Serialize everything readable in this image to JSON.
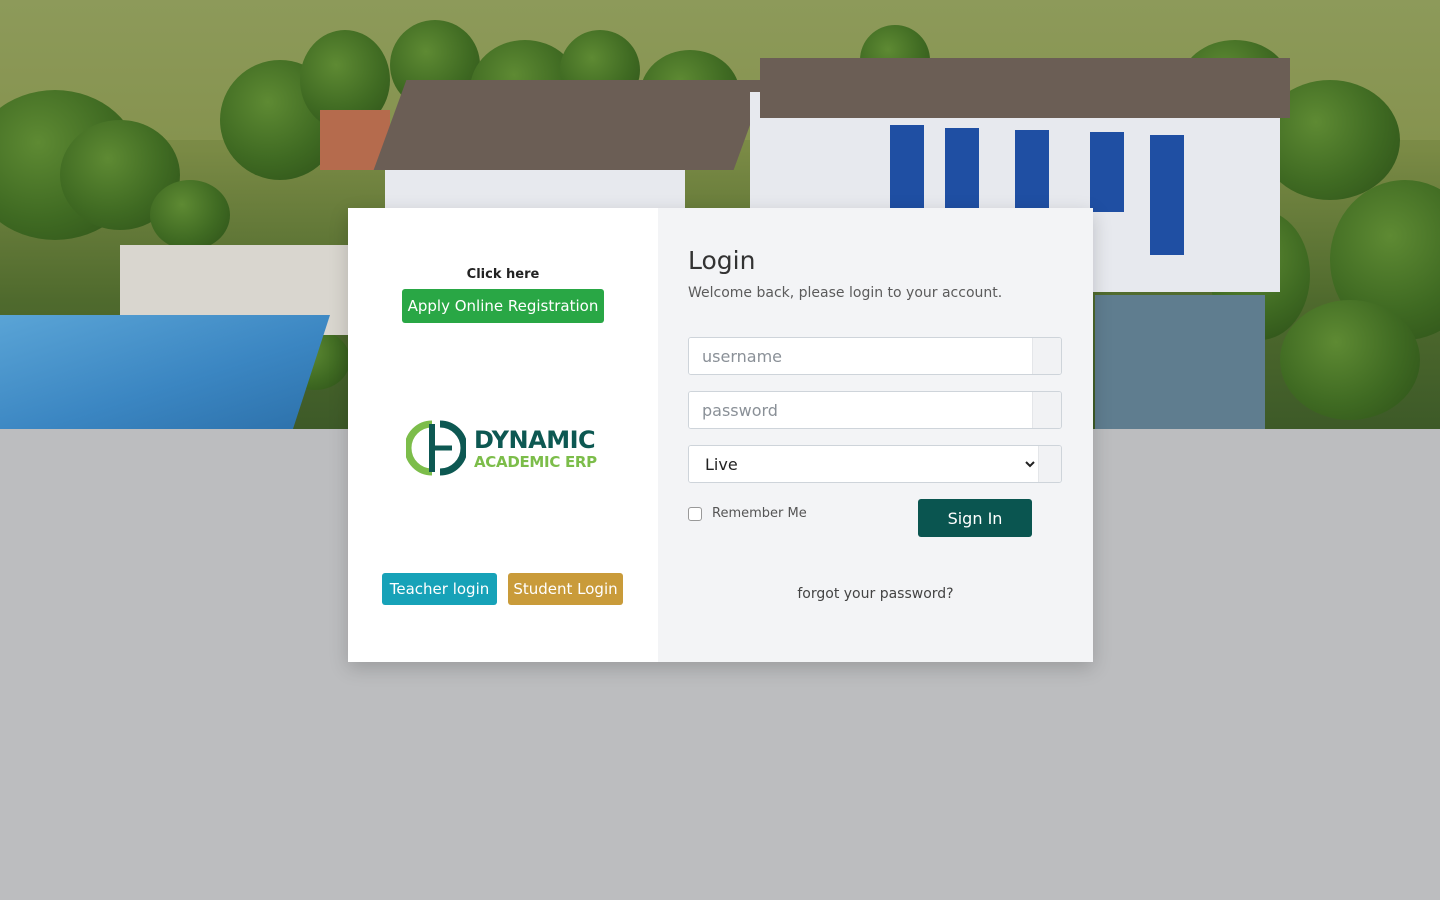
{
  "register_panel": {
    "click_here_label": "Click here",
    "register_button_label": "Apply Online Registration"
  },
  "logo": {
    "line1": "DYNAMIC",
    "line2": "ACADEMIC ERP",
    "colors": {
      "primary": "#0d5852",
      "secondary": "#7cbd4a"
    }
  },
  "quick_login": {
    "teacher_label": "Teacher login",
    "student_label": "Student Login"
  },
  "login_form": {
    "title": "Login",
    "subtitle": "Welcome back, please login to your account.",
    "username_placeholder": "username",
    "username_value": "",
    "password_placeholder": "password",
    "password_value": "",
    "environment_selected": "Live",
    "remember_label": "Remember Me",
    "remember_checked": false,
    "signin_label": "Sign In",
    "forgot_label": "forgot your password?"
  },
  "colors": {
    "register_button": "#29a745",
    "teacher_button": "#17a2b8",
    "student_button": "#c99b3a",
    "signin_button": "#0a5550",
    "page_background": "#bcbdbf",
    "form_panel_background": "#f3f4f6"
  }
}
